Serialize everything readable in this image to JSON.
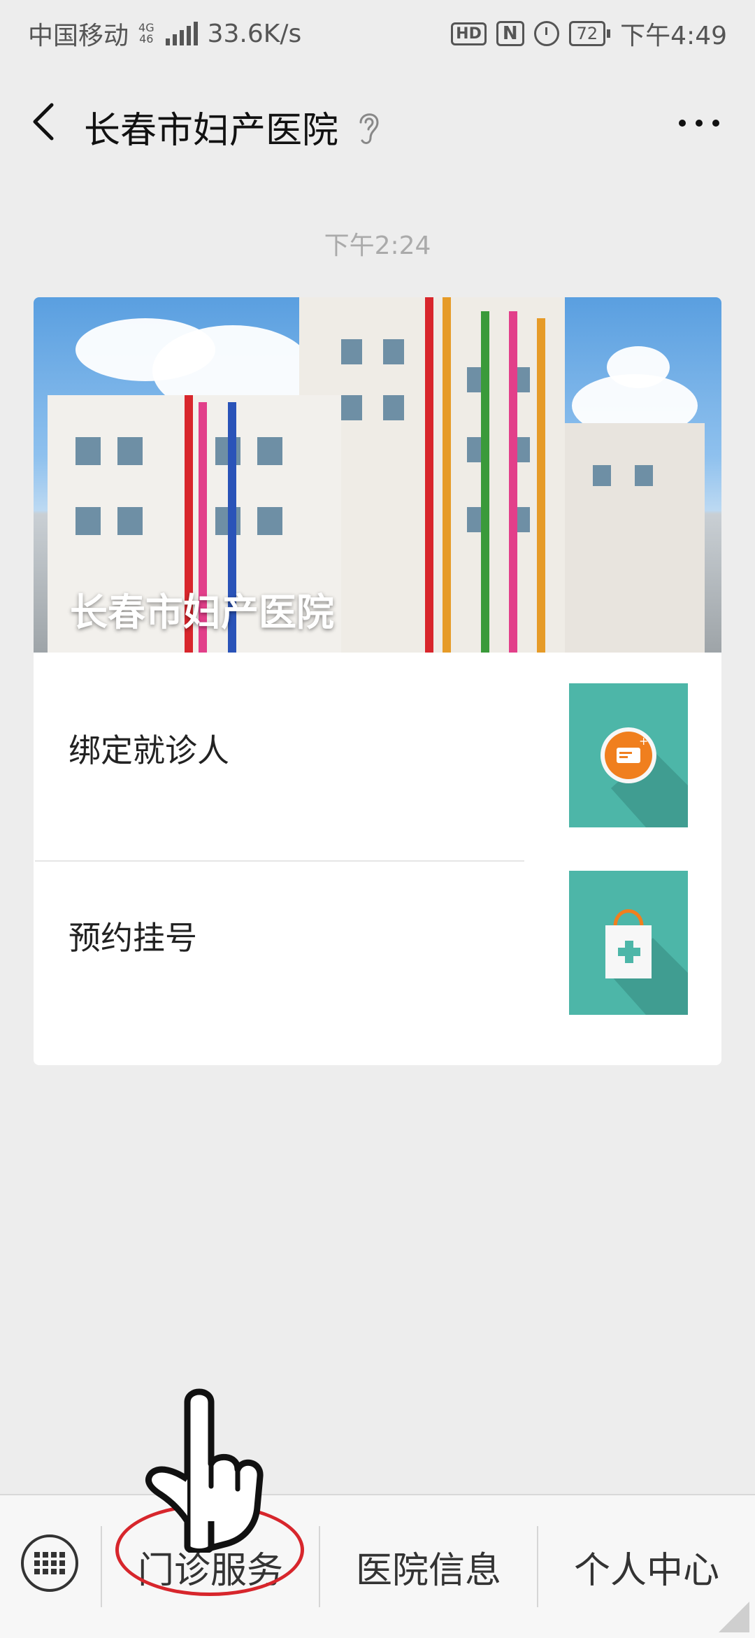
{
  "status_bar": {
    "carrier": "中国移动",
    "network_top": "4G",
    "network_bottom": "46",
    "speed": "33.6K/s",
    "hd": "HD",
    "nfc": "N",
    "battery": "72",
    "time": "下午4:49"
  },
  "header": {
    "title": "长春市妇产医院"
  },
  "chat": {
    "timestamp": "下午2:24"
  },
  "card": {
    "banner_title": "长春市妇产医院",
    "items": [
      {
        "label": "绑定就诊人",
        "icon": "id-card-icon"
      },
      {
        "label": "预约挂号",
        "icon": "medical-bag-icon"
      }
    ]
  },
  "bottom_menu": {
    "items": [
      {
        "label": "门诊服务"
      },
      {
        "label": "医院信息"
      },
      {
        "label": "个人中心"
      }
    ]
  },
  "colors": {
    "accent_teal": "#4db6a8",
    "highlight_red": "#d7262c",
    "icon_orange": "#f07f1e"
  }
}
